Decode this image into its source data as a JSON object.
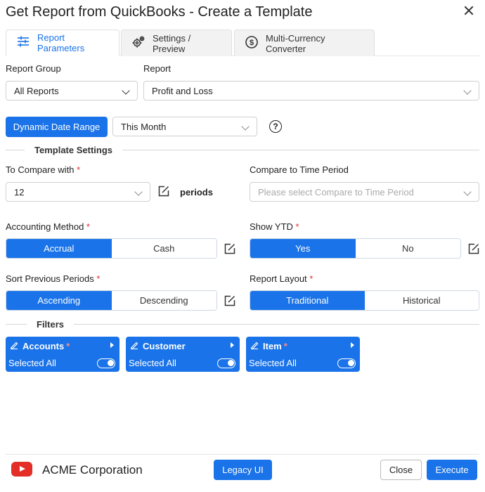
{
  "window": {
    "title": "Get Report from QuickBooks - Create a Template"
  },
  "tabs": [
    {
      "label": "Report Parameters",
      "active": true
    },
    {
      "label": "Settings / Preview",
      "active": false
    },
    {
      "label": "Multi-Currency Converter",
      "active": false
    }
  ],
  "report_group": {
    "label": "Report Group",
    "value": "All Reports"
  },
  "report": {
    "label": "Report",
    "value": "Profit and Loss"
  },
  "date_range": {
    "button_label": "Dynamic Date Range",
    "value": "This Month",
    "help": "?"
  },
  "template_settings": {
    "title": "Template Settings"
  },
  "compare_with": {
    "label": "To Compare with",
    "value": "12",
    "suffix": "periods"
  },
  "compare_period": {
    "label": "Compare to Time Period",
    "placeholder": "Please select Compare to Time Period"
  },
  "accounting_method": {
    "label": "Accounting Method",
    "options": [
      "Accrual",
      "Cash"
    ],
    "selected": "Accrual"
  },
  "show_ytd": {
    "label": "Show YTD",
    "options": [
      "Yes",
      "No"
    ],
    "selected": "Yes"
  },
  "sort_periods": {
    "label": "Sort Previous Periods",
    "options": [
      "Ascending",
      "Descending"
    ],
    "selected": "Ascending"
  },
  "report_layout": {
    "label": "Report Layout",
    "options": [
      "Traditional",
      "Historical"
    ],
    "selected": "Traditional"
  },
  "filters": {
    "title": "Filters",
    "items": [
      {
        "name": "Accounts",
        "required": true,
        "status": "Selected All",
        "enabled": true
      },
      {
        "name": "Customer",
        "required": false,
        "status": "Selected All",
        "enabled": true
      },
      {
        "name": "Item",
        "required": true,
        "status": "Selected All",
        "enabled": true
      }
    ]
  },
  "footer": {
    "company": "ACME Corporation",
    "legacy_label": "Legacy UI",
    "close_label": "Close",
    "execute_label": "Execute"
  },
  "colors": {
    "primary": "#1a73e8",
    "required": "#e03131",
    "youtube": "#e52d27"
  }
}
